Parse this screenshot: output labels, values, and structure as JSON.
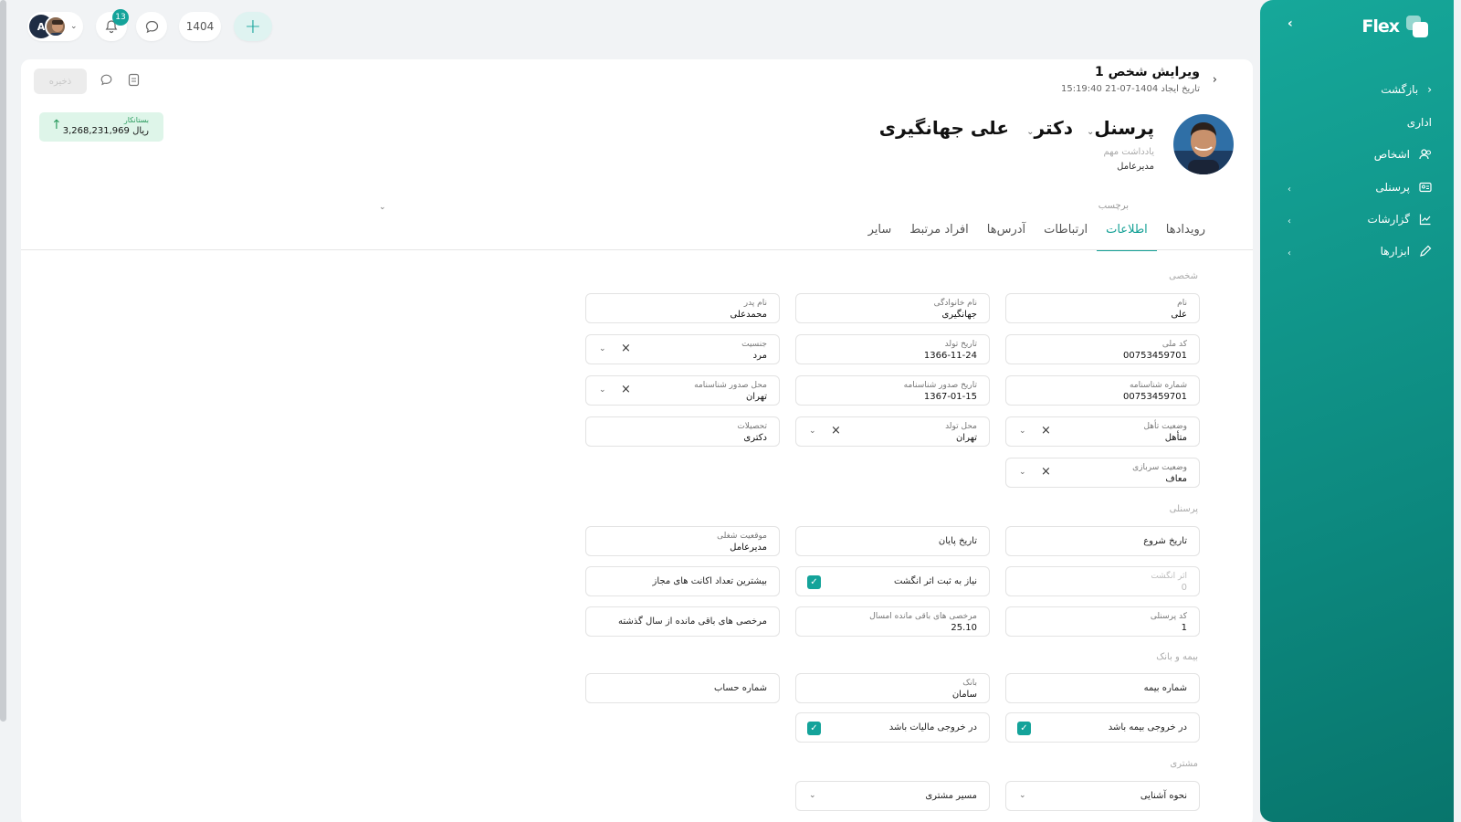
{
  "topbar": {
    "avatar_initial": "A",
    "notification_count": "13",
    "year": "1404"
  },
  "page": {
    "title": "ویرایش شخص 1",
    "created_at": "تاریخ ایجاد 1404-07-21 15:19:40",
    "save_label": "ذخیره",
    "balance_label": "بستانکار",
    "balance_value": "3,268,231,969 ریال",
    "person_name": "علی جهانگیری",
    "person_title": "دکتر",
    "person_role": "پرسنل",
    "note_label": "یادداشت مهم",
    "note_value": "مدیرعامل",
    "tag_label": "برچسب"
  },
  "tabs": [
    {
      "label": "رویدادها",
      "active": false
    },
    {
      "label": "اطلاعات",
      "active": true
    },
    {
      "label": "ارتباطات",
      "active": false
    },
    {
      "label": "آدرس‌ها",
      "active": false
    },
    {
      "label": "افراد مرتبط",
      "active": false
    },
    {
      "label": "سایر",
      "active": false
    }
  ],
  "sections": {
    "personal": "شخصی",
    "staff": "پرسنلی",
    "insurance": "بیمه و بانک",
    "customer": "مشتری"
  },
  "fields": {
    "first_name": {
      "label": "نام",
      "value": "علی"
    },
    "last_name": {
      "label": "نام خانوادگی",
      "value": "جهانگیری"
    },
    "father_name": {
      "label": "نام پدر",
      "value": "محمدعلی"
    },
    "national_code": {
      "label": "کد ملی",
      "value": "00753459701"
    },
    "birth_date": {
      "label": "تاریخ تولد",
      "value": "1366-11-24"
    },
    "gender": {
      "label": "جنسیت",
      "value": "مرد"
    },
    "id_number": {
      "label": "شماره شناسنامه",
      "value": "00753459701"
    },
    "id_issue_date": {
      "label": "تاریخ صدور شناسنامه",
      "value": "1367-01-15"
    },
    "id_issue_place": {
      "label": "محل صدور شناسنامه",
      "value": "تهران"
    },
    "marital": {
      "label": "وضعیت تأهل",
      "value": "متأهل"
    },
    "birth_place": {
      "label": "محل تولد",
      "value": "تهران"
    },
    "education": {
      "label": "تحصیلات",
      "value": "دکتری"
    },
    "military": {
      "label": "وضعیت سربازی",
      "value": "معاف"
    },
    "start_date": {
      "label": "تاریخ شروع"
    },
    "end_date": {
      "label": "تاریخ پایان"
    },
    "job_position": {
      "label": "موقعیت شغلی",
      "value": "مدیرعامل"
    },
    "fingerprint": {
      "label": "اثر انگشت",
      "value": "0"
    },
    "need_fingerprint": {
      "label": "نیاز به ثبت اثر انگشت"
    },
    "max_accounts": {
      "label": "بیشترین تعداد اکانت های مجاز"
    },
    "staff_code": {
      "label": "کد پرسنلی",
      "value": "1"
    },
    "leave_this_year": {
      "label": "مرخصی های باقی مانده امسال",
      "value": "25.10"
    },
    "leave_last_year": {
      "label": "مرخصی های باقی مانده از سال گذشته"
    },
    "insurance_number": {
      "label": "شماره بیمه"
    },
    "bank": {
      "label": "بانک",
      "value": "سامان"
    },
    "account_number": {
      "label": "شماره حساب"
    },
    "in_insurance_output": {
      "label": "در خروجی بیمه باشد"
    },
    "in_tax_output": {
      "label": "در خروجی مالیات باشد"
    },
    "acquaintance": {
      "label": "نحوه آشنایی"
    },
    "customer_path": {
      "label": "مسیر مشتری"
    }
  },
  "sidebar": {
    "logo": "Flex",
    "items": [
      {
        "label": "بازگشت",
        "icon": "chevron-right-icon"
      },
      {
        "label": "اداری",
        "icon": ""
      },
      {
        "label": "اشخاص",
        "icon": "users-icon"
      },
      {
        "label": "پرسنلی",
        "icon": "id-card-icon"
      },
      {
        "label": "گزارشات",
        "icon": "chart-icon"
      },
      {
        "label": "ابزارها",
        "icon": "pencil-icon"
      }
    ]
  },
  "colors": {
    "accent": "#14a39a",
    "balance_bg": "#def5e9"
  }
}
